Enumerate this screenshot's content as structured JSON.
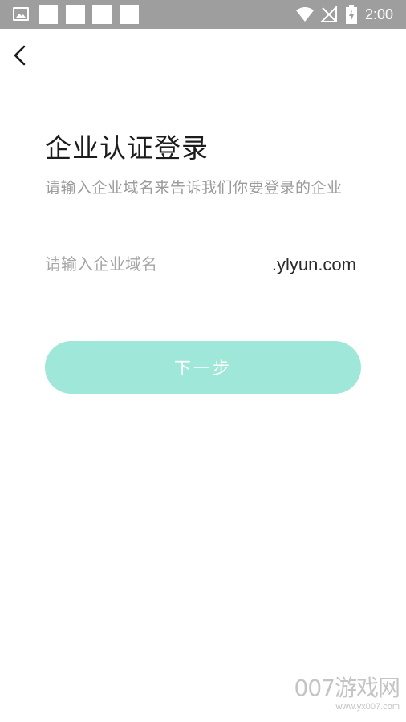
{
  "status_bar": {
    "time": "2:00",
    "icons": [
      "gallery-icon",
      "notification-square-icon",
      "notification-square-icon",
      "notification-square-icon",
      "notification-square-icon",
      "wifi-icon",
      "no-signal-icon",
      "battery-charging-icon"
    ]
  },
  "header": {
    "back_icon": "chevron-left-icon"
  },
  "main": {
    "title": "企业认证登录",
    "subtitle": "请输入企业域名来告诉我们你要登录的企业",
    "domain_input": {
      "value": "",
      "placeholder": "请输入企业域名"
    },
    "domain_suffix": ".ylyun.com",
    "next_button_label": "下一步"
  },
  "watermark": {
    "logo_text": "007游戏网",
    "url": "www.yx007.com"
  },
  "colors": {
    "status_bar": "#9e9e9e",
    "accent_underline": "#3ab6a8",
    "button_bg": "#9fe7d8",
    "title_text": "#1c1c1c",
    "subtitle_text": "#9b9b9b"
  }
}
